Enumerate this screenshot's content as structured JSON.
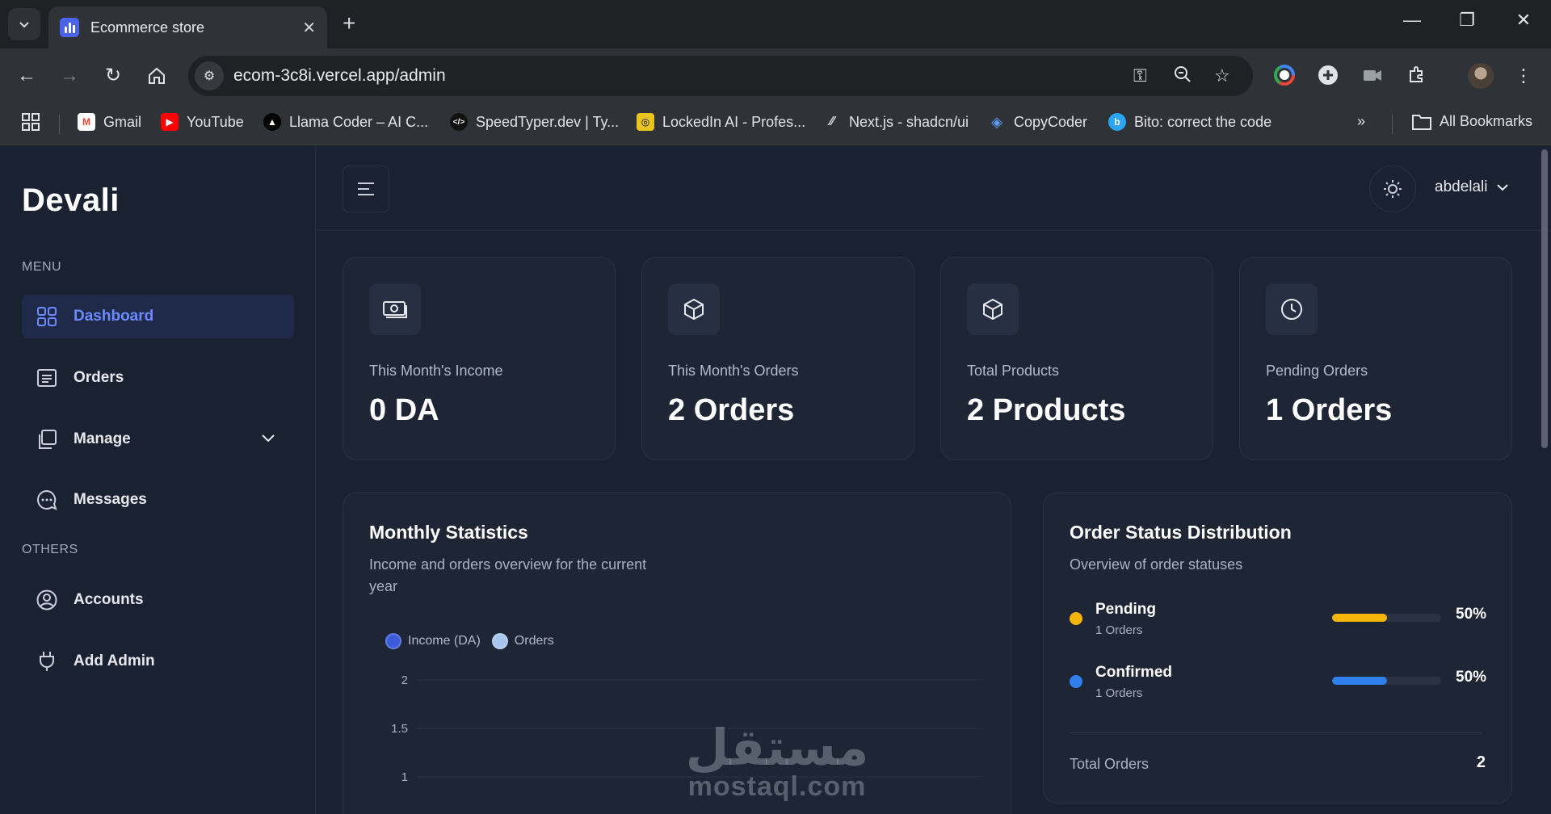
{
  "browser": {
    "tab_title": "Ecommerce store",
    "url": "ecom-3c8i.vercel.app/admin",
    "bookmarks": [
      {
        "label": "Gmail",
        "icon": "gmail-icon",
        "color": "#ea4335"
      },
      {
        "label": "YouTube",
        "icon": "youtube-icon",
        "color": "#ff0000"
      },
      {
        "label": "Llama Coder – AI C...",
        "icon": "llama-coder-icon",
        "color": "#000000"
      },
      {
        "label": "SpeedTyper.dev | Ty...",
        "icon": "speedtyper-icon",
        "color": "#111111"
      },
      {
        "label": "LockedIn AI - Profes...",
        "icon": "lockedin-icon",
        "color": "#e8c51c"
      },
      {
        "label": "Next.js - shadcn/ui",
        "icon": "shadcn-icon",
        "color": "#2f3236"
      },
      {
        "label": "CopyCoder",
        "icon": "copycoder-icon",
        "color": "#3b82f6"
      },
      {
        "label": "Bito: correct the code",
        "icon": "bito-icon",
        "color": "#2aa4f4"
      }
    ],
    "all_bookmarks_label": "All Bookmarks"
  },
  "sidebar": {
    "brand": "Devali",
    "menu_label": "MENU",
    "others_label": "OTHERS",
    "menu_items": [
      {
        "label": "Dashboard",
        "icon": "grid-icon",
        "active": true
      },
      {
        "label": "Orders",
        "icon": "list-icon"
      },
      {
        "label": "Manage",
        "icon": "copy-icon"
      },
      {
        "label": "Messages",
        "icon": "chat-icon"
      }
    ],
    "other_items": [
      {
        "label": "Accounts",
        "icon": "user-circle-icon"
      },
      {
        "label": "Add Admin",
        "icon": "plug-icon"
      }
    ]
  },
  "header": {
    "username": "abdelali"
  },
  "stats": [
    {
      "label": "This Month's Income",
      "value": "0 DA",
      "icon": "money-icon"
    },
    {
      "label": "This Month's Orders",
      "value": "2 Orders",
      "icon": "box-icon"
    },
    {
      "label": "Total Products",
      "value": "2 Products",
      "icon": "box-icon"
    },
    {
      "label": "Pending Orders",
      "value": "1 Orders",
      "icon": "clock-icon"
    }
  ],
  "monthly": {
    "title": "Monthly Statistics",
    "subtitle_line1": "Income and orders overview for the current",
    "subtitle_line2": "year",
    "legend_income": "Income (DA)",
    "legend_orders": "Orders",
    "colors": {
      "income": "#3b5bdb",
      "orders": "#a8c5f0"
    }
  },
  "chart_data": {
    "type": "bar",
    "series": [
      {
        "name": "Income (DA)",
        "values": []
      },
      {
        "name": "Orders",
        "values": []
      }
    ],
    "y_ticks": [
      "2",
      "1.5",
      "1"
    ],
    "grid": true,
    "legend": "top-left"
  },
  "status": {
    "title": "Order Status Distribution",
    "subtitle": "Overview of order statuses",
    "items": [
      {
        "name": "Pending",
        "count": "1 Orders",
        "percent_label": "50%",
        "percent": 50,
        "color": "#f5b50b"
      },
      {
        "name": "Confirmed",
        "count": "1 Orders",
        "percent_label": "50%",
        "percent": 50,
        "color": "#2f80ed"
      }
    ],
    "total_label": "Total Orders",
    "total_value": "2"
  },
  "watermark": {
    "arabic": "مستقل",
    "latin": "mostaql.com"
  }
}
